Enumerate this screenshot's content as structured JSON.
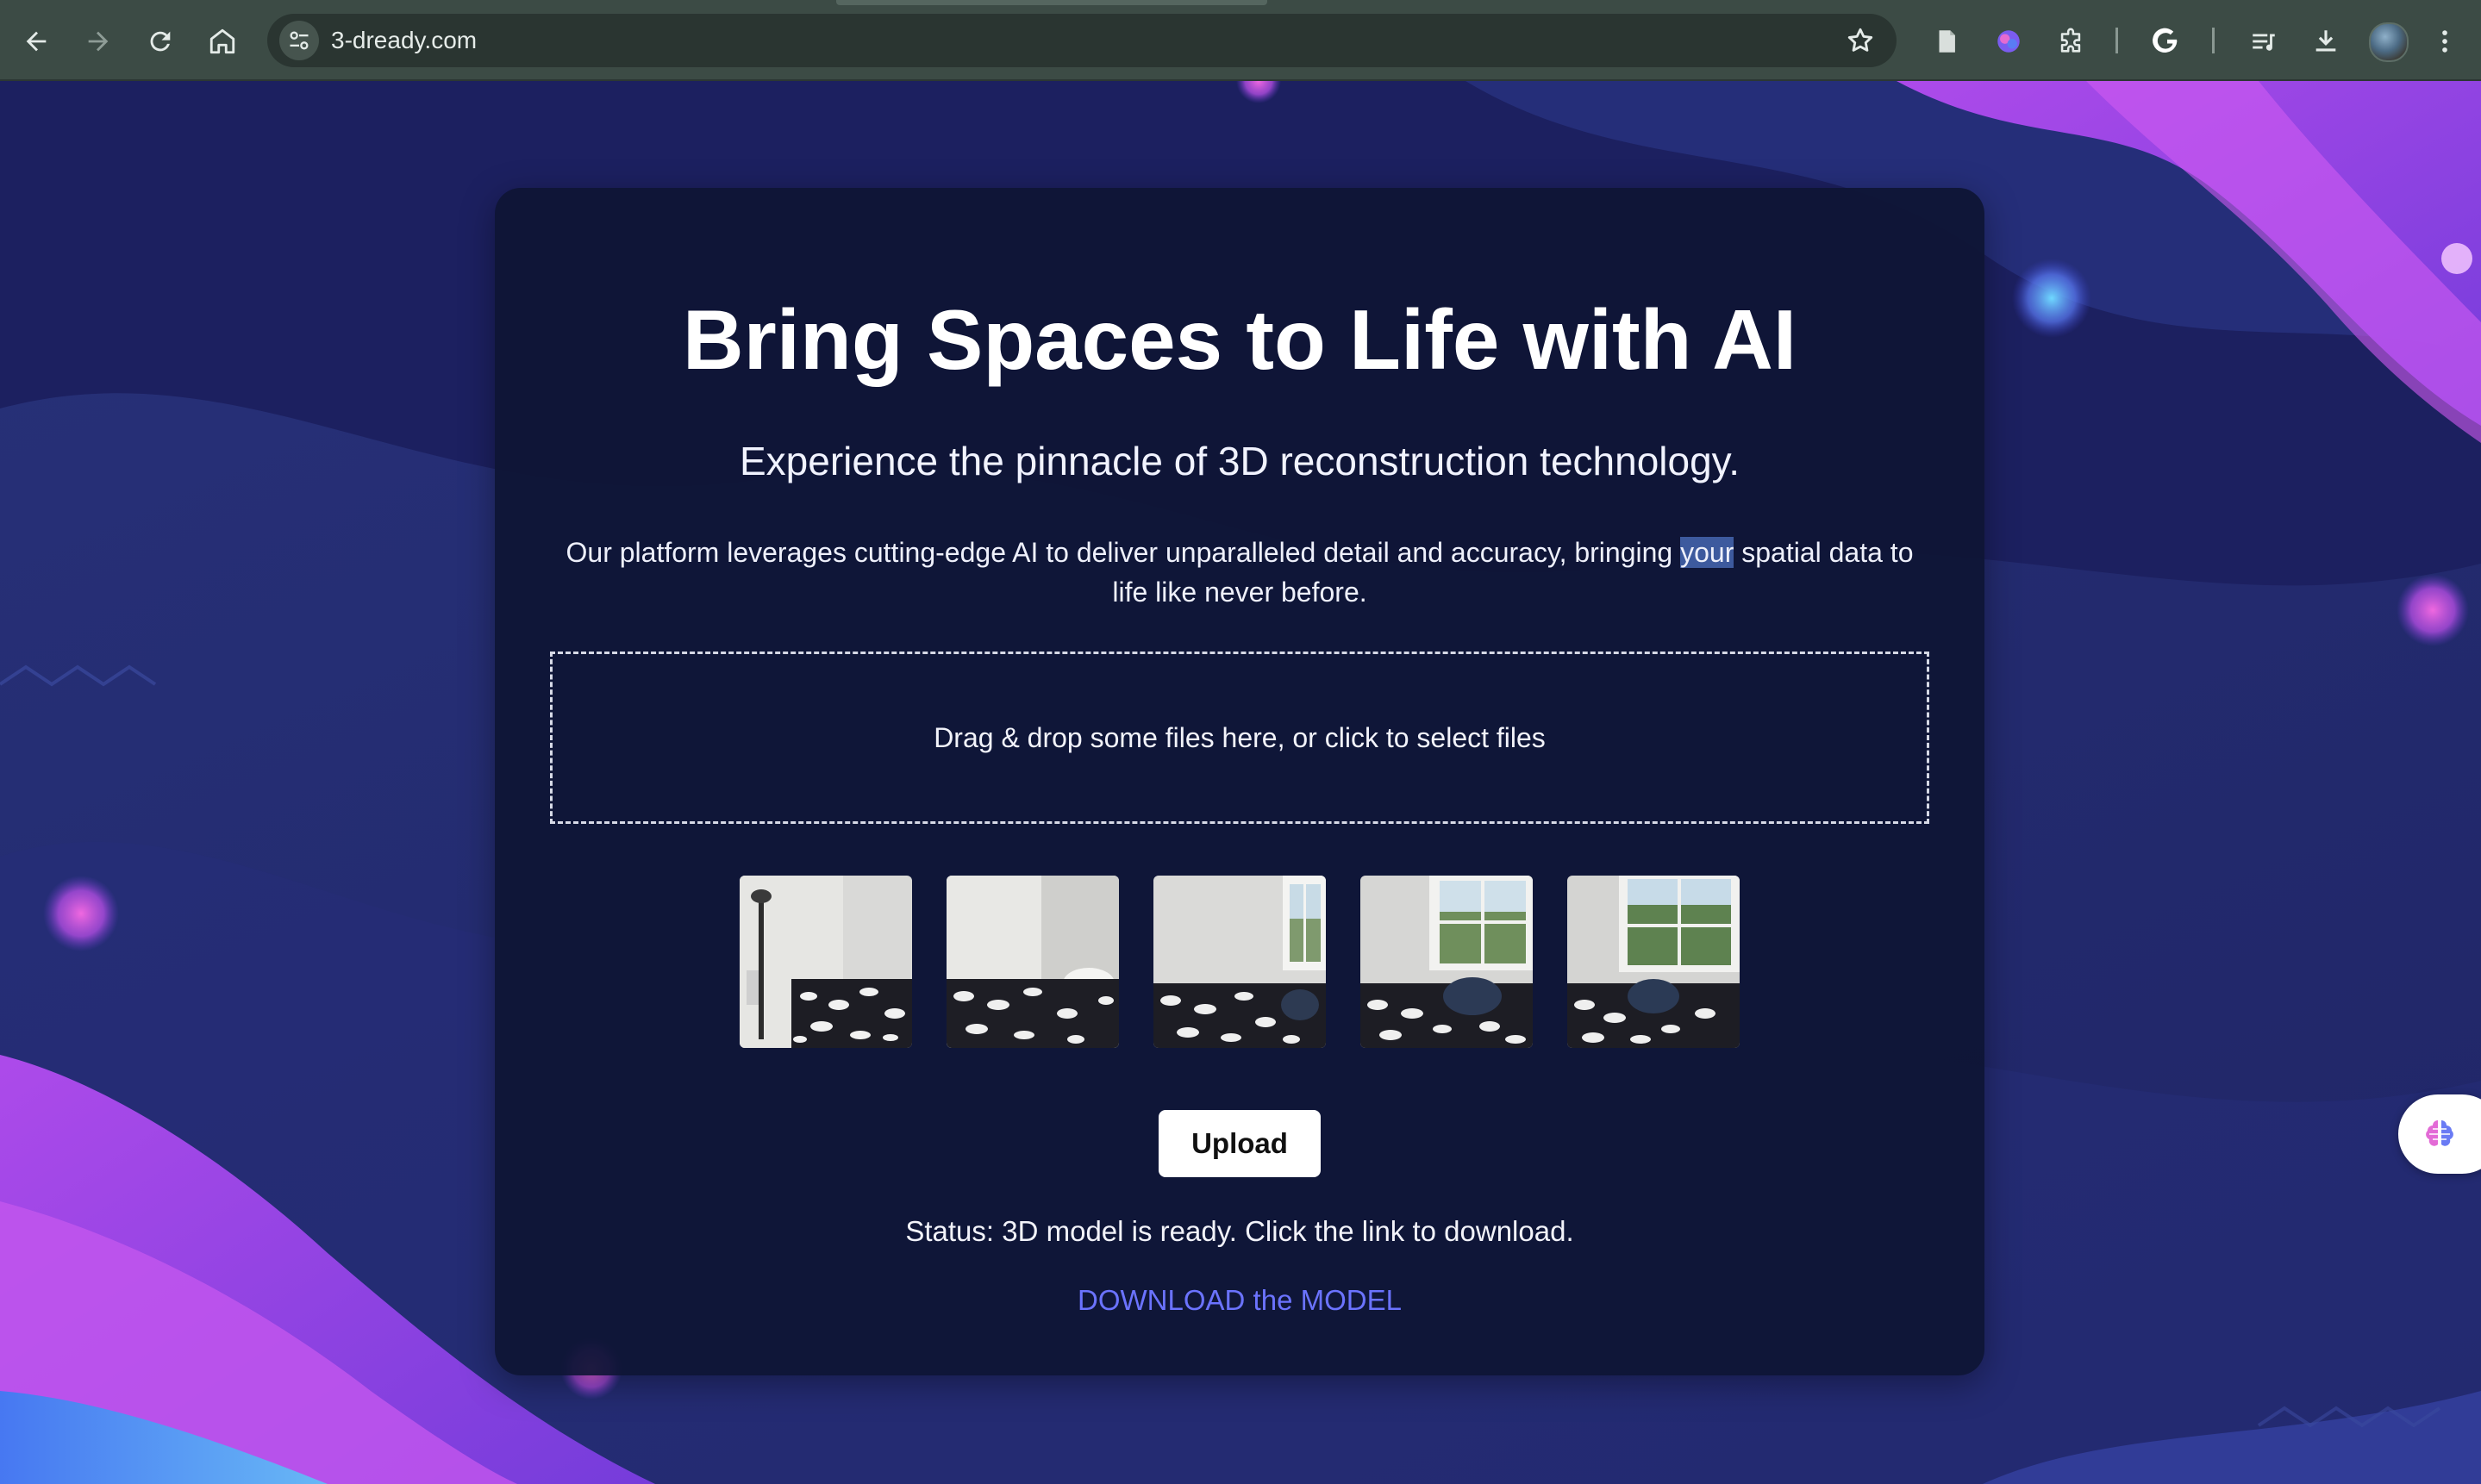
{
  "browser": {
    "url": "3-dready.com",
    "nav": {
      "back_icon": "arrow-left-icon",
      "forward_icon": "arrow-right-icon",
      "reload_icon": "reload-icon",
      "home_icon": "home-icon"
    },
    "extensions": [
      "document-icon",
      "brain-extension-icon",
      "puzzle-icon",
      "google-icon",
      "reading-list-icon",
      "download-icon",
      "profile-avatar",
      "kebab-menu-icon"
    ]
  },
  "hero": {
    "title": "Bring Spaces to Life with AI",
    "subtitle": "Experience the pinnacle of 3D reconstruction technology.",
    "description_before": "Our platform leverages cutting-edge AI to deliver unparalleled detail and accuracy, bringing ",
    "description_highlight": "your",
    "description_after": " spatial data to life like never before."
  },
  "upload": {
    "dropzone_text": "Drag & drop some files here, or click to select files",
    "thumbnail_count": 5,
    "button_label": "Upload"
  },
  "result": {
    "status": "Status: 3D model is ready. Click the link to download.",
    "download_link": "DOWNLOAD the MODEL"
  },
  "colors": {
    "accent_link": "#6b73ff",
    "card_bg": "#0e1434",
    "page_bg": "#1a1e5a",
    "chrome_bg": "#3c4b45"
  }
}
